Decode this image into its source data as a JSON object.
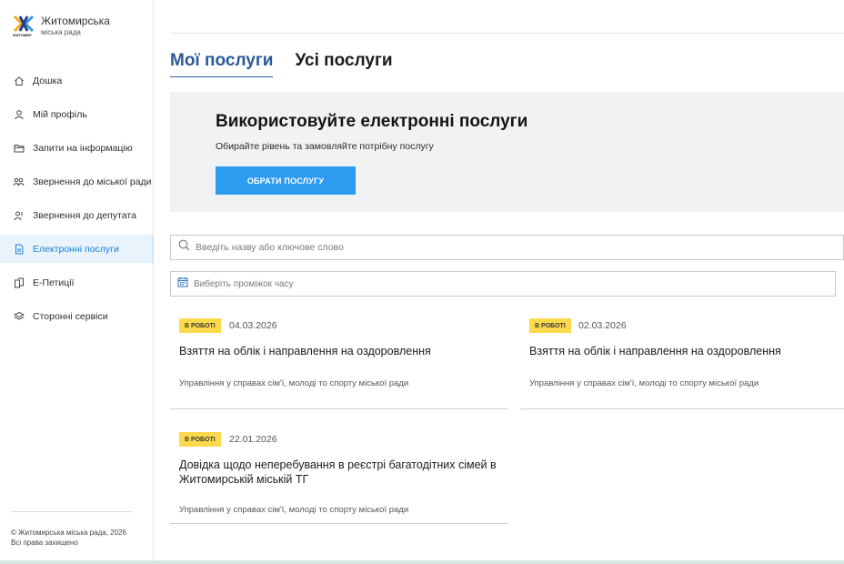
{
  "logo": {
    "title": "Житомирська",
    "subtitle": "міська рада",
    "caption": "ЖИТОМИР",
    "colors": [
      "#f2a81d",
      "#1f3f8f",
      "#3c9ad4"
    ]
  },
  "sidebar": {
    "items": [
      {
        "label": "Дошка",
        "icon": "home-icon"
      },
      {
        "label": "Мій профіль",
        "icon": "user-icon"
      },
      {
        "label": "Запити на інформацію",
        "icon": "folder-icon"
      },
      {
        "label": "Звернення до міської ради",
        "icon": "group-icon"
      },
      {
        "label": "Звернення до депутата",
        "icon": "deputy-icon"
      },
      {
        "label": "Електронні послуги",
        "icon": "document-icon",
        "active": true
      },
      {
        "label": "Е-Петиції",
        "icon": "petition-icon"
      },
      {
        "label": "Сторонні сервіси",
        "icon": "layers-icon"
      }
    ]
  },
  "footer": {
    "line1": "© Житомирська міська рада, 2026",
    "line2": "Всі права захищено"
  },
  "tabs": [
    {
      "label": "Мої послуги",
      "active": true
    },
    {
      "label": "Усі послуги",
      "active": false
    }
  ],
  "banner": {
    "title": "Використовуйте електронні послуги",
    "text": "Обирайте рівень та замовляйте потрібну послугу",
    "button": "ОБРАТИ ПОСЛУГУ"
  },
  "search": {
    "placeholder": "Введіть назву або ключове слово"
  },
  "date_filter": {
    "placeholder": "Виберіть проміжок часу"
  },
  "cards": [
    {
      "status": "В РОБОТІ",
      "date": "04.03.2026",
      "title": "Взяття на облік і направлення на оздоровлення",
      "department": "Управління у справах сім'ї, молоді то спорту міської ради"
    },
    {
      "status": "В РОБОТІ",
      "date": "02.03.2026",
      "title": "Взяття на облік і направлення на оздоровлення",
      "department": "Управління у справах сім'ї, молоді то спорту міської ради"
    },
    {
      "status": "В РОБОТІ",
      "date": "22.01.2026",
      "title": "Довідка щодо неперебування в реєстрі багатодітних сімей в Житомирській міській ТГ",
      "department": "Управління у справах сім'ї, молоді то спорту міської ради"
    }
  ],
  "colors": {
    "accent": "#2d9cf0",
    "tab_active": "#2a5a9a",
    "badge": "#fcd94a",
    "sidebar_active_bg": "#e8f3fc"
  }
}
